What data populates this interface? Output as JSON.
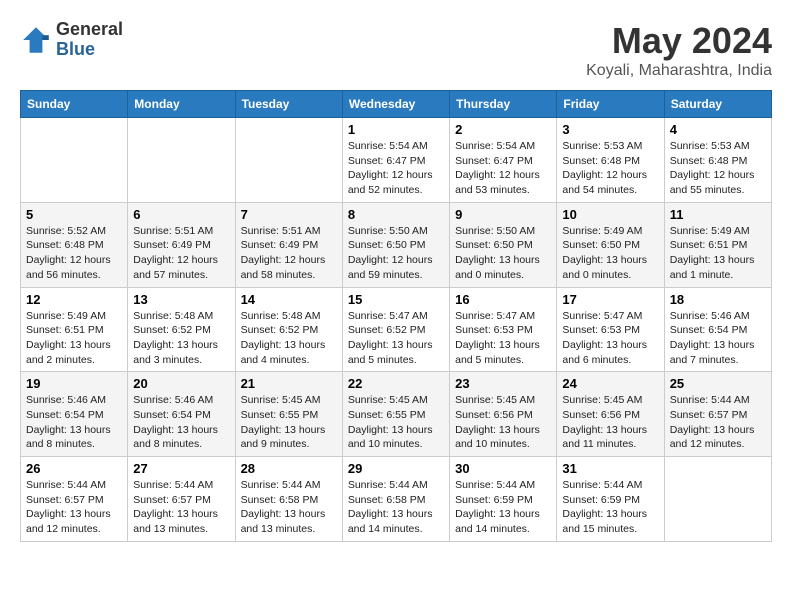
{
  "header": {
    "logo_line1": "General",
    "logo_line2": "Blue",
    "title": "May 2024",
    "subtitle": "Koyali, Maharashtra, India"
  },
  "days_of_week": [
    "Sunday",
    "Monday",
    "Tuesday",
    "Wednesday",
    "Thursday",
    "Friday",
    "Saturday"
  ],
  "weeks": [
    [
      {
        "num": "",
        "sunrise": "",
        "sunset": "",
        "daylight": ""
      },
      {
        "num": "",
        "sunrise": "",
        "sunset": "",
        "daylight": ""
      },
      {
        "num": "",
        "sunrise": "",
        "sunset": "",
        "daylight": ""
      },
      {
        "num": "1",
        "sunrise": "Sunrise: 5:54 AM",
        "sunset": "Sunset: 6:47 PM",
        "daylight": "Daylight: 12 hours and 52 minutes."
      },
      {
        "num": "2",
        "sunrise": "Sunrise: 5:54 AM",
        "sunset": "Sunset: 6:47 PM",
        "daylight": "Daylight: 12 hours and 53 minutes."
      },
      {
        "num": "3",
        "sunrise": "Sunrise: 5:53 AM",
        "sunset": "Sunset: 6:48 PM",
        "daylight": "Daylight: 12 hours and 54 minutes."
      },
      {
        "num": "4",
        "sunrise": "Sunrise: 5:53 AM",
        "sunset": "Sunset: 6:48 PM",
        "daylight": "Daylight: 12 hours and 55 minutes."
      }
    ],
    [
      {
        "num": "5",
        "sunrise": "Sunrise: 5:52 AM",
        "sunset": "Sunset: 6:48 PM",
        "daylight": "Daylight: 12 hours and 56 minutes."
      },
      {
        "num": "6",
        "sunrise": "Sunrise: 5:51 AM",
        "sunset": "Sunset: 6:49 PM",
        "daylight": "Daylight: 12 hours and 57 minutes."
      },
      {
        "num": "7",
        "sunrise": "Sunrise: 5:51 AM",
        "sunset": "Sunset: 6:49 PM",
        "daylight": "Daylight: 12 hours and 58 minutes."
      },
      {
        "num": "8",
        "sunrise": "Sunrise: 5:50 AM",
        "sunset": "Sunset: 6:50 PM",
        "daylight": "Daylight: 12 hours and 59 minutes."
      },
      {
        "num": "9",
        "sunrise": "Sunrise: 5:50 AM",
        "sunset": "Sunset: 6:50 PM",
        "daylight": "Daylight: 13 hours and 0 minutes."
      },
      {
        "num": "10",
        "sunrise": "Sunrise: 5:49 AM",
        "sunset": "Sunset: 6:50 PM",
        "daylight": "Daylight: 13 hours and 0 minutes."
      },
      {
        "num": "11",
        "sunrise": "Sunrise: 5:49 AM",
        "sunset": "Sunset: 6:51 PM",
        "daylight": "Daylight: 13 hours and 1 minute."
      }
    ],
    [
      {
        "num": "12",
        "sunrise": "Sunrise: 5:49 AM",
        "sunset": "Sunset: 6:51 PM",
        "daylight": "Daylight: 13 hours and 2 minutes."
      },
      {
        "num": "13",
        "sunrise": "Sunrise: 5:48 AM",
        "sunset": "Sunset: 6:52 PM",
        "daylight": "Daylight: 13 hours and 3 minutes."
      },
      {
        "num": "14",
        "sunrise": "Sunrise: 5:48 AM",
        "sunset": "Sunset: 6:52 PM",
        "daylight": "Daylight: 13 hours and 4 minutes."
      },
      {
        "num": "15",
        "sunrise": "Sunrise: 5:47 AM",
        "sunset": "Sunset: 6:52 PM",
        "daylight": "Daylight: 13 hours and 5 minutes."
      },
      {
        "num": "16",
        "sunrise": "Sunrise: 5:47 AM",
        "sunset": "Sunset: 6:53 PM",
        "daylight": "Daylight: 13 hours and 5 minutes."
      },
      {
        "num": "17",
        "sunrise": "Sunrise: 5:47 AM",
        "sunset": "Sunset: 6:53 PM",
        "daylight": "Daylight: 13 hours and 6 minutes."
      },
      {
        "num": "18",
        "sunrise": "Sunrise: 5:46 AM",
        "sunset": "Sunset: 6:54 PM",
        "daylight": "Daylight: 13 hours and 7 minutes."
      }
    ],
    [
      {
        "num": "19",
        "sunrise": "Sunrise: 5:46 AM",
        "sunset": "Sunset: 6:54 PM",
        "daylight": "Daylight: 13 hours and 8 minutes."
      },
      {
        "num": "20",
        "sunrise": "Sunrise: 5:46 AM",
        "sunset": "Sunset: 6:54 PM",
        "daylight": "Daylight: 13 hours and 8 minutes."
      },
      {
        "num": "21",
        "sunrise": "Sunrise: 5:45 AM",
        "sunset": "Sunset: 6:55 PM",
        "daylight": "Daylight: 13 hours and 9 minutes."
      },
      {
        "num": "22",
        "sunrise": "Sunrise: 5:45 AM",
        "sunset": "Sunset: 6:55 PM",
        "daylight": "Daylight: 13 hours and 10 minutes."
      },
      {
        "num": "23",
        "sunrise": "Sunrise: 5:45 AM",
        "sunset": "Sunset: 6:56 PM",
        "daylight": "Daylight: 13 hours and 10 minutes."
      },
      {
        "num": "24",
        "sunrise": "Sunrise: 5:45 AM",
        "sunset": "Sunset: 6:56 PM",
        "daylight": "Daylight: 13 hours and 11 minutes."
      },
      {
        "num": "25",
        "sunrise": "Sunrise: 5:44 AM",
        "sunset": "Sunset: 6:57 PM",
        "daylight": "Daylight: 13 hours and 12 minutes."
      }
    ],
    [
      {
        "num": "26",
        "sunrise": "Sunrise: 5:44 AM",
        "sunset": "Sunset: 6:57 PM",
        "daylight": "Daylight: 13 hours and 12 minutes."
      },
      {
        "num": "27",
        "sunrise": "Sunrise: 5:44 AM",
        "sunset": "Sunset: 6:57 PM",
        "daylight": "Daylight: 13 hours and 13 minutes."
      },
      {
        "num": "28",
        "sunrise": "Sunrise: 5:44 AM",
        "sunset": "Sunset: 6:58 PM",
        "daylight": "Daylight: 13 hours and 13 minutes."
      },
      {
        "num": "29",
        "sunrise": "Sunrise: 5:44 AM",
        "sunset": "Sunset: 6:58 PM",
        "daylight": "Daylight: 13 hours and 14 minutes."
      },
      {
        "num": "30",
        "sunrise": "Sunrise: 5:44 AM",
        "sunset": "Sunset: 6:59 PM",
        "daylight": "Daylight: 13 hours and 14 minutes."
      },
      {
        "num": "31",
        "sunrise": "Sunrise: 5:44 AM",
        "sunset": "Sunset: 6:59 PM",
        "daylight": "Daylight: 13 hours and 15 minutes."
      },
      {
        "num": "",
        "sunrise": "",
        "sunset": "",
        "daylight": ""
      }
    ]
  ]
}
